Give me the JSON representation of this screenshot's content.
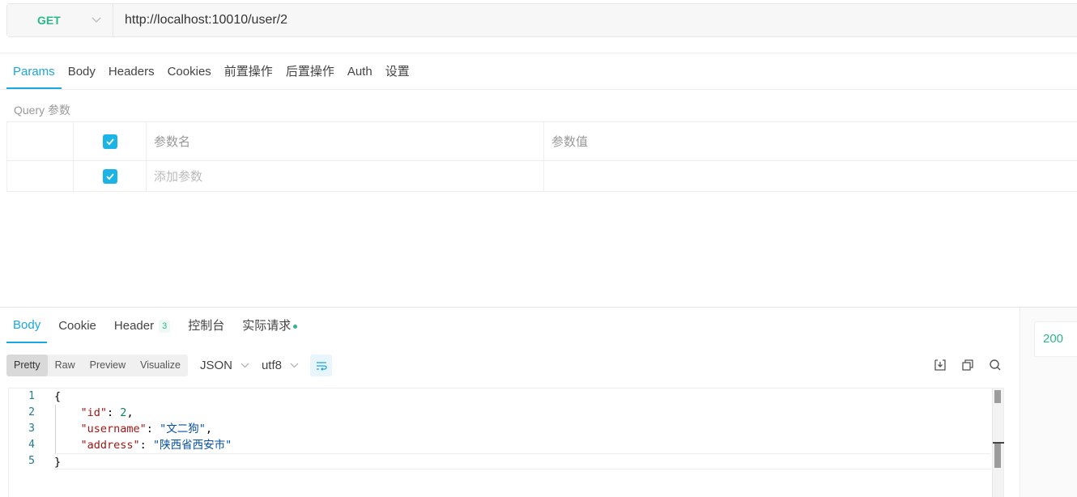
{
  "request": {
    "method": "GET",
    "url": "http://localhost:10010/user/2",
    "tabs": [
      "Params",
      "Body",
      "Headers",
      "Cookies",
      "前置操作",
      "后置操作",
      "Auth",
      "设置"
    ],
    "active_tab": "Params",
    "query_label": "Query 参数",
    "params_table": {
      "header": {
        "name": "参数名",
        "value": "参数值"
      },
      "add_placeholder": "添加参数"
    }
  },
  "response": {
    "tabs": [
      {
        "label": "Body"
      },
      {
        "label": "Cookie"
      },
      {
        "label": "Header",
        "badge": "3"
      },
      {
        "label": "控制台"
      },
      {
        "label": "实际请求",
        "dot": true
      }
    ],
    "active_tab": "Body",
    "view_modes": [
      "Pretty",
      "Raw",
      "Preview",
      "Visualize"
    ],
    "active_view": "Pretty",
    "format": "JSON",
    "encoding": "utf8",
    "status_code": "200",
    "code_lines": [
      "1",
      "2",
      "3",
      "4",
      "5"
    ],
    "json": {
      "open": "{",
      "id_key": "\"id\"",
      "id_val": "2",
      "username_key": "\"username\"",
      "username_val": "\"文二狗\"",
      "address_key": "\"address\"",
      "address_val": "\"陕西省西安市\"",
      "close": "}"
    }
  },
  "colors": {
    "accent": "#1aa6e0",
    "method_green": "#2db888",
    "checkbox": "#1cb3e5"
  },
  "icons": [
    "chevron-down-icon",
    "checkbox-checked-icon",
    "wrap-lines-icon",
    "download-icon",
    "copy-icon",
    "search-icon"
  ]
}
